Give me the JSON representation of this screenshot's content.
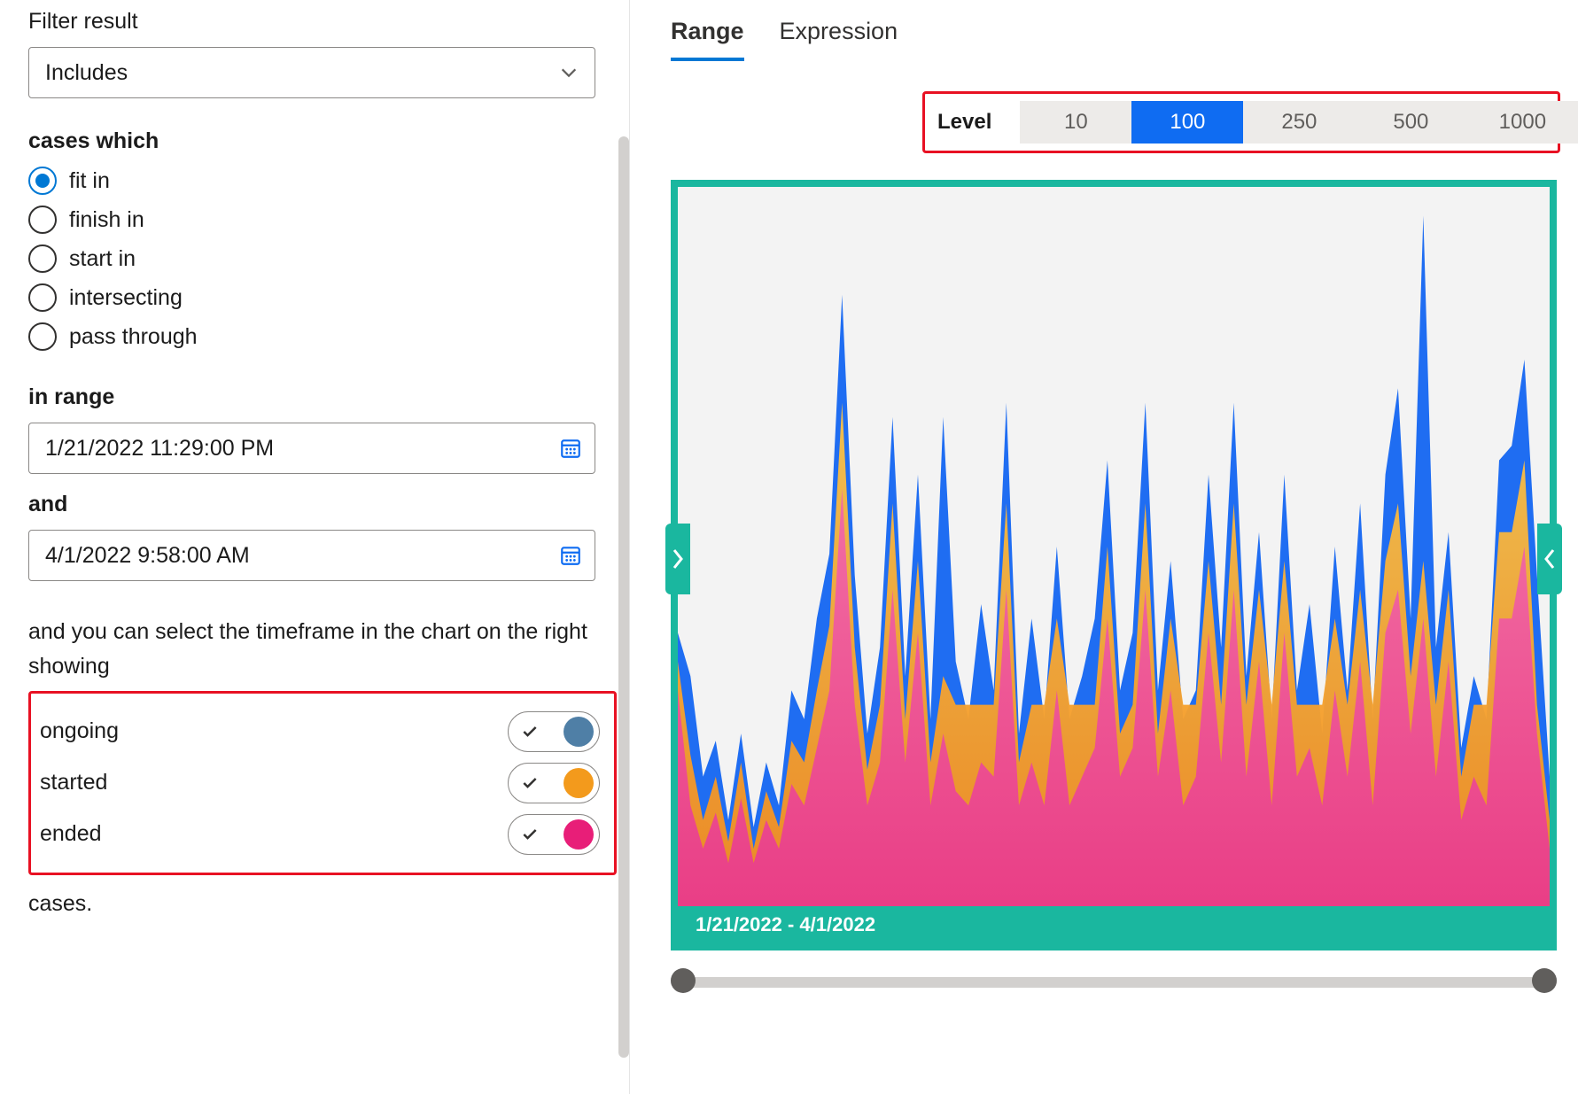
{
  "left": {
    "filter_label": "Filter result",
    "filter_value": "Includes",
    "cases_label": "cases which",
    "radios": {
      "fit_in": "fit in",
      "finish_in": "finish in",
      "start_in": "start in",
      "intersecting": "intersecting",
      "pass_through": "pass through"
    },
    "in_range_label": "in range",
    "from_date": "1/21/2022 11:29:00 PM",
    "and_label": "and",
    "to_date": "4/1/2022 9:58:00 AM",
    "hint": "and you can select the timeframe in the chart on the right showing",
    "legend": {
      "ongoing": "ongoing",
      "started": "started",
      "ended": "ended"
    },
    "cases_tail": "cases."
  },
  "right": {
    "tabs": {
      "range": "Range",
      "expression": "Expression"
    },
    "level_label": "Level",
    "levels": {
      "l10": "10",
      "l100": "100",
      "l250": "250",
      "l500": "500",
      "l1000": "1000"
    },
    "chart_range": "1/21/2022 - 4/1/2022"
  },
  "colors": {
    "blue": "#1f6df2",
    "orange": "#f39a1c",
    "pink": "#e93b8a",
    "teal": "#1ab79f",
    "steelblue": "#4f7fa6"
  },
  "chart_data": {
    "type": "area",
    "title": "",
    "xlabel": "",
    "ylabel": "",
    "x_range": [
      "1/21/2022",
      "4/1/2022"
    ],
    "ylim": [
      0,
      100
    ],
    "legend": [
      "ongoing",
      "started",
      "ended"
    ],
    "x": [
      0,
      1,
      2,
      3,
      4,
      5,
      6,
      7,
      8,
      9,
      10,
      11,
      12,
      13,
      14,
      15,
      16,
      17,
      18,
      19,
      20,
      21,
      22,
      23,
      24,
      25,
      26,
      27,
      28,
      29,
      30,
      31,
      32,
      33,
      34,
      35,
      36,
      37,
      38,
      39,
      40,
      41,
      42,
      43,
      44,
      45,
      46,
      47,
      48,
      49,
      50,
      51,
      52,
      53,
      54,
      55,
      56,
      57,
      58,
      59,
      60,
      61,
      62,
      63,
      64,
      65,
      66,
      67,
      68,
      69
    ],
    "series": [
      {
        "name": "ongoing",
        "color": "#1f6df2",
        "values": [
          38,
          32,
          18,
          23,
          12,
          24,
          11,
          20,
          14,
          30,
          26,
          40,
          49,
          85,
          46,
          24,
          36,
          68,
          32,
          60,
          26,
          68,
          34,
          26,
          42,
          30,
          70,
          24,
          40,
          26,
          50,
          26,
          32,
          40,
          62,
          30,
          38,
          70,
          30,
          48,
          26,
          30,
          60,
          36,
          70,
          32,
          52,
          26,
          60,
          30,
          42,
          24,
          50,
          30,
          56,
          26,
          60,
          72,
          40,
          96,
          36,
          52,
          22,
          32,
          26,
          62,
          64,
          76,
          46,
          18
        ]
      },
      {
        "name": "started",
        "color": "#f39a1c",
        "values": [
          34,
          21,
          12,
          18,
          9,
          20,
          8,
          16,
          11,
          23,
          20,
          30,
          39,
          70,
          36,
          19,
          28,
          56,
          26,
          48,
          20,
          32,
          28,
          28,
          28,
          28,
          56,
          20,
          28,
          28,
          40,
          28,
          28,
          28,
          50,
          24,
          28,
          56,
          24,
          40,
          28,
          28,
          48,
          28,
          56,
          28,
          44,
          28,
          48,
          28,
          28,
          28,
          40,
          28,
          44,
          28,
          48,
          56,
          32,
          48,
          28,
          44,
          18,
          28,
          28,
          52,
          52,
          62,
          28,
          12
        ]
      },
      {
        "name": "ended",
        "color": "#e93b8a",
        "values": [
          30,
          14,
          8,
          13,
          6,
          15,
          6,
          12,
          8,
          17,
          14,
          22,
          30,
          58,
          28,
          14,
          20,
          44,
          20,
          38,
          14,
          24,
          16,
          14,
          20,
          18,
          44,
          14,
          20,
          14,
          30,
          14,
          18,
          22,
          40,
          18,
          22,
          44,
          18,
          30,
          14,
          18,
          38,
          20,
          44,
          18,
          34,
          14,
          38,
          18,
          22,
          14,
          30,
          18,
          34,
          14,
          38,
          44,
          24,
          40,
          18,
          34,
          12,
          18,
          14,
          40,
          40,
          50,
          24,
          8
        ]
      }
    ]
  }
}
